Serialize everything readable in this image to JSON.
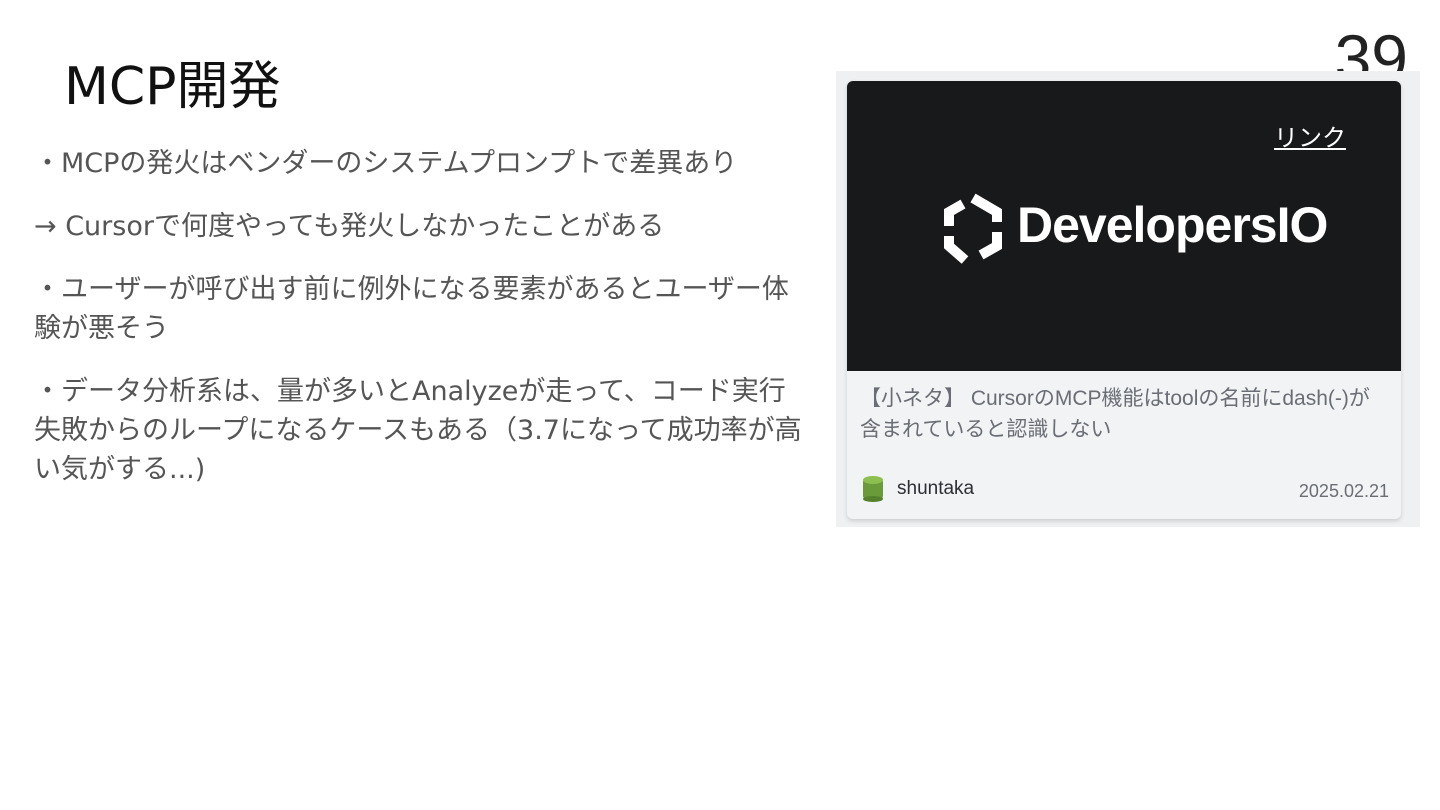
{
  "slide": {
    "title": "MCP開発",
    "page_number": "39",
    "bullets": [
      "・MCPの発火はベンダーのシステムプロンプトで差異あり",
      "→ Cursorで何度やっても発火しなかったことがある",
      "・ユーザーが呼び出す前に例外になる要素があるとユーザー体験が悪そう",
      "・データ分析系は、量が多いとAnalyzeが走って、コード実行失敗からのループになるケースもある（3.7になって成功率が高い気がする...)"
    ]
  },
  "card": {
    "link_label": "リンク",
    "brand_name": "DevelopersIO",
    "article_title": "【小ネタ】 CursorのMCP機能はtoolの名前にdash(-)が含まれていると認識しない",
    "author": "shuntaka",
    "date": "2025.02.21"
  },
  "colors": {
    "banner_bg": "#18191b",
    "avatar": "#6b9a3a"
  },
  "icons": {
    "brand": "developersio-hexagon-logo",
    "author": "author-avatar-icon"
  }
}
